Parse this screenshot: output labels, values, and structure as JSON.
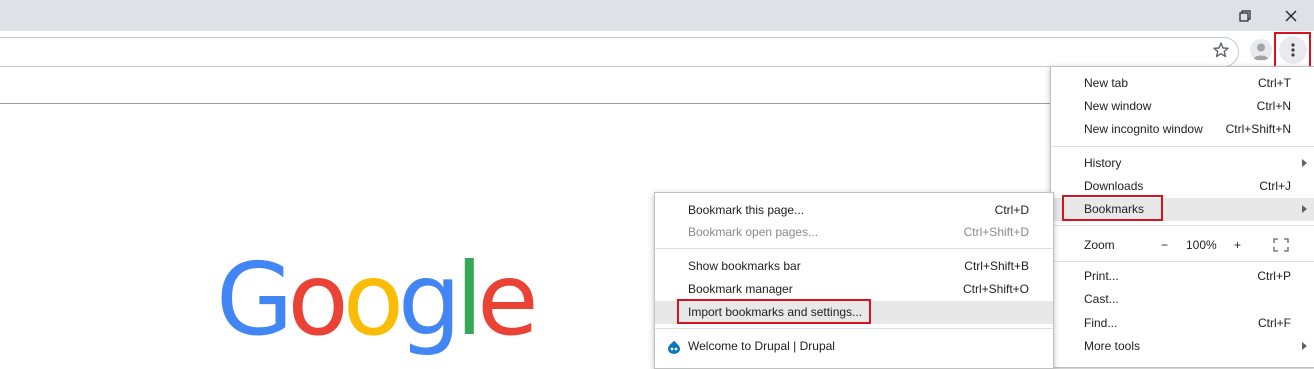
{
  "window_controls": {
    "restore_icon": "restore-icon",
    "close_icon": "close-icon"
  },
  "toolbar": {
    "bookmark_star_icon": "star-icon",
    "avatar_icon": "person-icon",
    "menu_icon": "more-vert-icon"
  },
  "colors": {
    "highlight_red": "#d9131d",
    "menu_hover": "#e8e8e8",
    "titlebar": "#dee1e6"
  },
  "google_logo": {
    "letters": [
      {
        "char": "G",
        "color": "#4285f4"
      },
      {
        "char": "o",
        "color": "#ea4335"
      },
      {
        "char": "o",
        "color": "#fbbc05"
      },
      {
        "char": "g",
        "color": "#4285f4"
      },
      {
        "char": "l",
        "color": "#34a853"
      },
      {
        "char": "e",
        "color": "#ea4335"
      }
    ]
  },
  "main_menu": {
    "new_tab": {
      "label": "New tab",
      "shortcut": "Ctrl+T"
    },
    "new_window": {
      "label": "New window",
      "shortcut": "Ctrl+N"
    },
    "new_incognito": {
      "label": "New incognito window",
      "shortcut": "Ctrl+Shift+N"
    },
    "history": {
      "label": "History"
    },
    "downloads": {
      "label": "Downloads",
      "shortcut": "Ctrl+J"
    },
    "bookmarks": {
      "label": "Bookmarks"
    },
    "zoom": {
      "label": "Zoom",
      "minus": "−",
      "value": "100%",
      "plus": "+",
      "fullscreen_icon": "fullscreen-icon"
    },
    "print": {
      "label": "Print...",
      "shortcut": "Ctrl+P"
    },
    "cast": {
      "label": "Cast..."
    },
    "find": {
      "label": "Find...",
      "shortcut": "Ctrl+F"
    },
    "more_tools": {
      "label": "More tools"
    }
  },
  "bookmarks_submenu": {
    "bookmark_page": {
      "label": "Bookmark this page...",
      "shortcut": "Ctrl+D"
    },
    "bookmark_open_pages": {
      "label": "Bookmark open pages...",
      "shortcut": "Ctrl+Shift+D"
    },
    "show_bar": {
      "label": "Show bookmarks bar",
      "shortcut": "Ctrl+Shift+B"
    },
    "manager": {
      "label": "Bookmark manager",
      "shortcut": "Ctrl+Shift+O"
    },
    "import": {
      "label": "Import bookmarks and settings..."
    },
    "drupal": {
      "label": "Welcome to Drupal | Drupal",
      "icon": "drupal-icon"
    }
  }
}
